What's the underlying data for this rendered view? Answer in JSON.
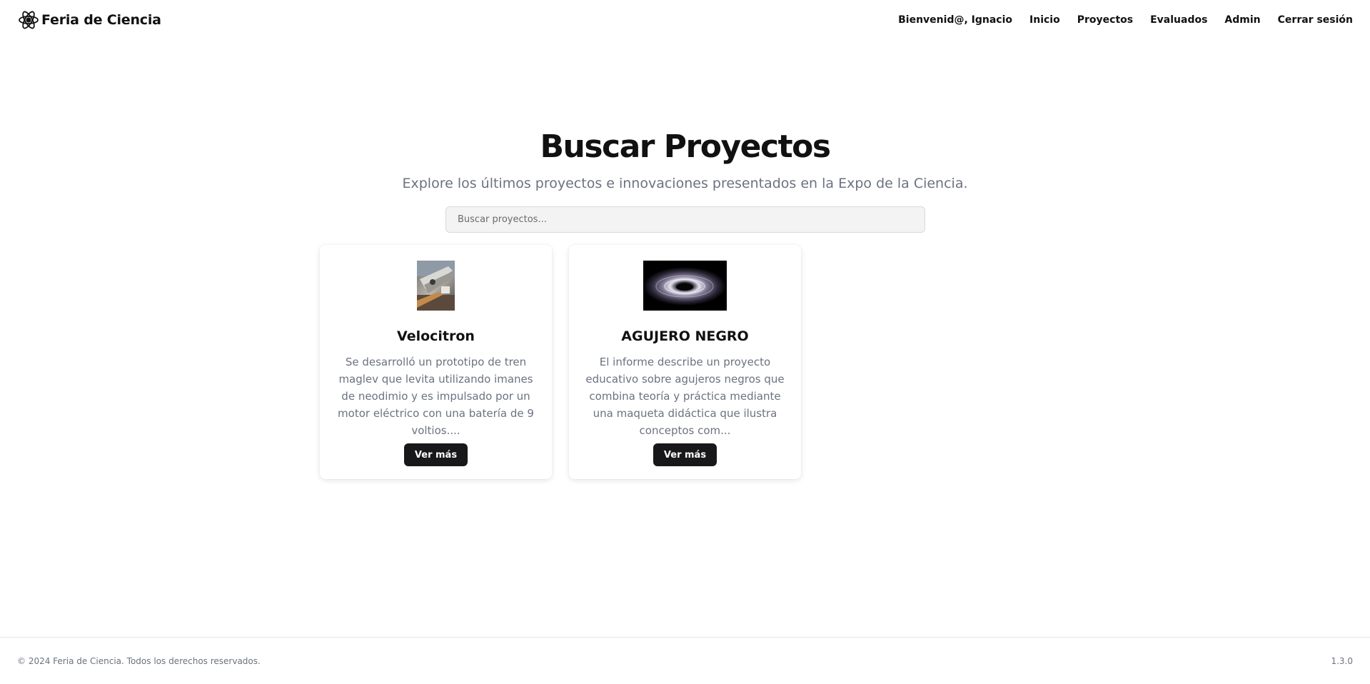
{
  "header": {
    "brand_name": "Feria de Ciencia",
    "brand_icon": "atom-icon",
    "nav": [
      {
        "label": "Bienvenid@, Ignacio"
      },
      {
        "label": "Inicio"
      },
      {
        "label": "Proyectos"
      },
      {
        "label": "Evaluados"
      },
      {
        "label": "Admin"
      },
      {
        "label": "Cerrar sesión"
      }
    ]
  },
  "hero": {
    "title": "Buscar Proyectos",
    "subtitle": "Explore los últimos proyectos e innovaciones presentados en la Expo de la Ciencia."
  },
  "search": {
    "placeholder": "Buscar proyectos...",
    "value": ""
  },
  "projects": [
    {
      "title": "Velocitron",
      "description": "Se desarrolló un prototipo de tren maglev que levita utilizando imanes de neodimio y es impulsado por un motor eléctrico con una batería de 9 voltios....",
      "button_label": "Ver más",
      "image": "maglev-train-photo"
    },
    {
      "title": "AGUJERO NEGRO",
      "description": "El informe describe un proyecto educativo sobre agujeros negros que combina teoría y práctica mediante una maqueta didáctica que ilustra conceptos com...",
      "button_label": "Ver más",
      "image": "black-hole-photo"
    }
  ],
  "footer": {
    "copyright": "© 2024 Feria de Ciencia. Todos los derechos reservados.",
    "version": "1.3.0"
  },
  "colors": {
    "primary_button": "#18181b",
    "muted_text": "#6b7280",
    "input_background": "#f3f3f3"
  }
}
